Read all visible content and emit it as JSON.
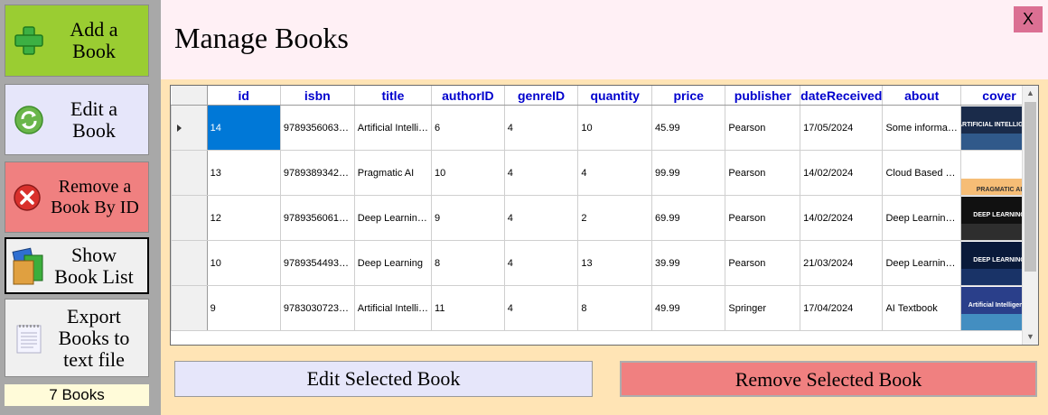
{
  "sidebar": {
    "add_label": "Add a\nBook",
    "edit_label": "Edit a\nBook",
    "remove_label": "Remove a\nBook By ID",
    "show_label": "Show\nBook List",
    "export_label": "Export\nBooks to\ntext file",
    "count_label": "7 Books"
  },
  "header": {
    "title": "Manage Books",
    "close_label": "X"
  },
  "grid": {
    "columns": [
      "id",
      "isbn",
      "title",
      "authorID",
      "genreID",
      "quantity",
      "price",
      "publisher",
      "dateReceived",
      "about",
      "cover"
    ],
    "rows": [
      {
        "id": "14",
        "isbn": "9789356063…",
        "title": "Artificial Intelli…",
        "authorID": "6",
        "genreID": "4",
        "quantity": "10",
        "price": "45.99",
        "publisher": "Pearson",
        "dateReceived": "17/05/2024",
        "about": "Some informa…",
        "cover": "ARTIFICIAL INTELLIGENCE"
      },
      {
        "id": "13",
        "isbn": "9789389342…",
        "title": "Pragmatic AI",
        "authorID": "10",
        "genreID": "4",
        "quantity": "4",
        "price": "99.99",
        "publisher": "Pearson",
        "dateReceived": "14/02/2024",
        "about": "Cloud Based …",
        "cover": "PRAGMATIC AI"
      },
      {
        "id": "12",
        "isbn": "9789356061…",
        "title": "Deep Learnin…",
        "authorID": "9",
        "genreID": "4",
        "quantity": "2",
        "price": "69.99",
        "publisher": "Pearson",
        "dateReceived": "14/02/2024",
        "about": "Deep Learnin…",
        "cover": "DEEP LEARNING"
      },
      {
        "id": "10",
        "isbn": "9789354493…",
        "title": "Deep Learning",
        "authorID": "8",
        "genreID": "4",
        "quantity": "13",
        "price": "39.99",
        "publisher": "Pearson",
        "dateReceived": "21/03/2024",
        "about": "Deep Learnin…",
        "cover": "DEEP LEARNING"
      },
      {
        "id": "9",
        "isbn": "9783030723…",
        "title": "Artificial Intelli…",
        "authorID": "11",
        "genreID": "4",
        "quantity": "8",
        "price": "49.99",
        "publisher": "Springer",
        "dateReceived": "17/04/2024",
        "about": "AI Textbook",
        "cover": "Artificial Intelligence"
      }
    ]
  },
  "actions": {
    "edit_label": "Edit Selected Book",
    "remove_label": "Remove Selected Book"
  },
  "colors": {
    "add": "#9acd32",
    "edit": "#e6e6fa",
    "remove": "#f08080",
    "header": "#fff0f5",
    "main": "#ffe4b5",
    "close": "#db7093",
    "count": "#fffbd9",
    "column_header_text": "#0000cd",
    "selection": "#0078d7"
  }
}
